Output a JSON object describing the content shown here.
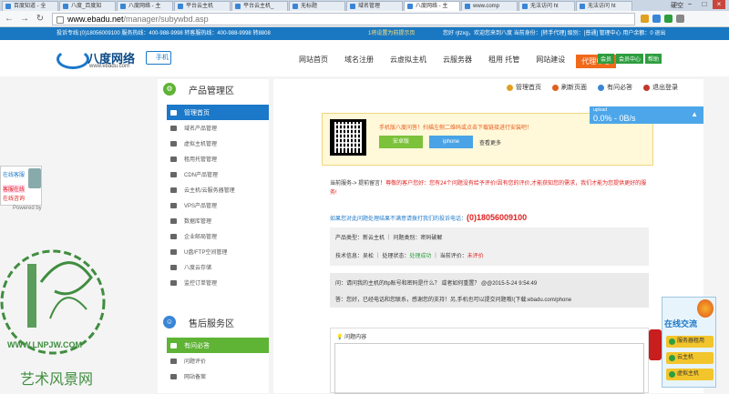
{
  "browser": {
    "tabs": [
      "百度知道 - 全",
      "八度_百度知",
      "八度网络 - 主",
      "平台云主机",
      "平台云主机_",
      "无标题",
      "域名管理",
      "八度网络 - 主",
      "www.comp",
      "无法访问 ht",
      "无法访问 ht"
    ],
    "active_tab": 7,
    "user_badge": "硬空",
    "url_host": "www.ebadu.net",
    "url_path": "/manager/subywbd.asp",
    "minimize": "−",
    "maximize": "□",
    "close": "×",
    "back": "←",
    "forward": "→",
    "reload": "↻"
  },
  "topstrip": {
    "left": "投诉专线:(0)18056009100  服务热线：400-988-9998  转客服热线：400-988-9998  转8808",
    "middle": "1将设置为前提示页",
    "right": "您好 rjtzxg，欢迎您来到八度 当前身份：[转手代理] 级别：[普通] 管理中心   用户余额：0   退出"
  },
  "header": {
    "logo_name": "八度网络",
    "logo_sub": "www.ebadu.com",
    "phone_label": "手机",
    "nav": [
      "网站首页",
      "域名注册",
      "云虚拟主机",
      "云服务器",
      "租用 托管",
      "网站建设",
      "代理中心"
    ],
    "nav_hot_index": 6,
    "login_buttons": [
      "会员",
      "会员中心",
      "帮助"
    ]
  },
  "sidebar": {
    "section1_title": "产品管理区",
    "section1_icon": "gear-icon",
    "items1": [
      "管理首页",
      "域名产品管理",
      "虚拟主机管理",
      "租用托管管理",
      "CDN产品管理",
      "云主机/云服务器管理",
      "VPS产品管理",
      "数据库管理",
      "企业邮局管理",
      "U盘/FTP空间管理",
      "八度云存储",
      "监控订单管理"
    ],
    "section2_title": "售后服务区",
    "section2_icon": "support-icon",
    "items2": [
      "有问必答",
      "问题评价",
      "网站备案"
    ]
  },
  "content": {
    "top_buttons": [
      "管理首页",
      "刷新页面",
      "有问必答",
      "退出登录"
    ],
    "app_tip": "手机版八度问答！扫描左侧二维码或点击下载链接进行安装吧！",
    "android_label": "安卓版",
    "iphone_label": "iphone",
    "more_label": "查看更多",
    "notice_prefix": "当前服务-> 提前留言！",
    "notice_red": "尊敬的客户您好：您有24个问题没有给予评价!因有您的评价,才能获知您的需求，我们才能为您提供更好的服务!",
    "contact_text": "如果您对此问题处理结果不满意请拨打我们的投诉电话：",
    "contact_phone": "(0)18056009100",
    "product_line": "产品类型：新云主机 ｜ 问题类别：密码破解",
    "tech_prefix": "技术信息：吴松 ｜ 处理状态：",
    "tech_status": "处理成功",
    "tech_eval_prefix": " ｜ 当前评价：",
    "tech_eval": "未评价",
    "question": "问：请问我的主机的ftp账号和密码是什么？ 或者如何重置？ @@2015-5-24 9:54:49",
    "answer": "答：您好，已经电话和您联系，感谢您的支持！另,手机也可以提交问题哦!(下载:ebadu.com/phone",
    "question_content_label": "问题内容"
  },
  "speed": {
    "label": "upload",
    "value": "0.0% - 0B/s",
    "arrow": "▲"
  },
  "left_chat": {
    "t1": "在线客服",
    "t2": "客服在线",
    "t3": "在线咨询",
    "powered": "Powered by"
  },
  "right_panel": {
    "head": "在线交流",
    "buttons": [
      "服务器租用",
      "云主机",
      "虚拟主机"
    ]
  },
  "watermark": {
    "site": "WWW.LNPJW.COM",
    "brand": "艺术风景网"
  }
}
